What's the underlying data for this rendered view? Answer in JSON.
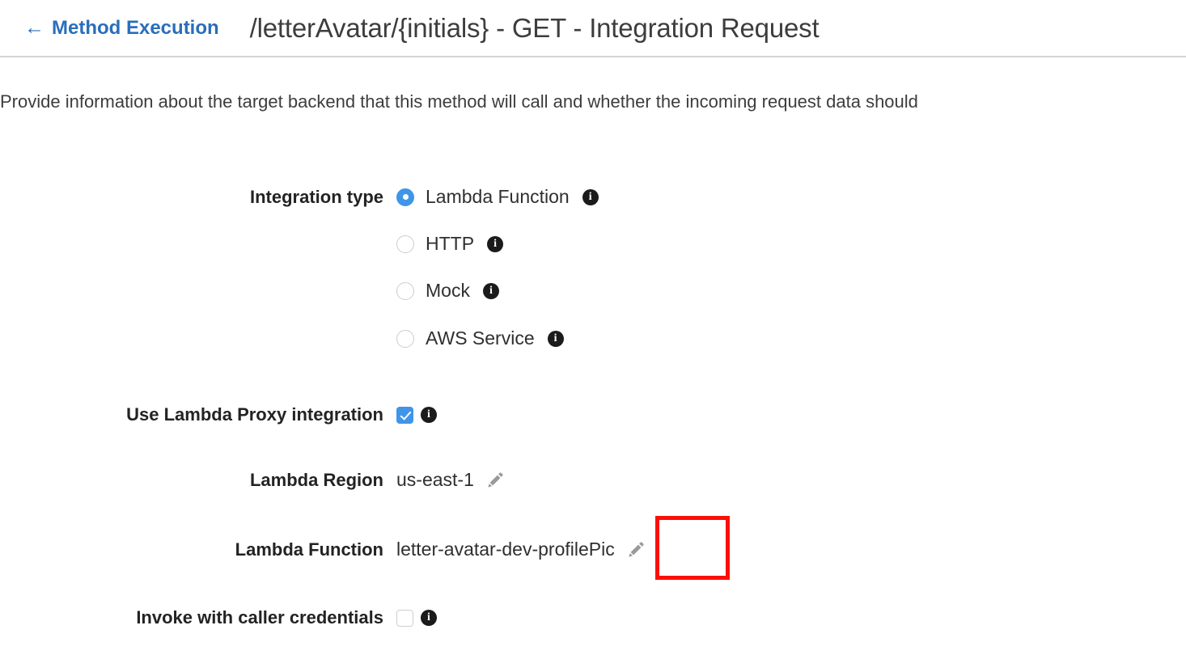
{
  "header": {
    "back_arrow_glyph": "←",
    "back_link_label": "Method Execution",
    "title": "/letterAvatar/{initials} - GET - Integration Request"
  },
  "description": "Provide information about the target backend that this method will call and whether the incoming request data should",
  "form": {
    "integration_type": {
      "label": "Integration type",
      "selected": "Lambda Function",
      "options": [
        {
          "label": "Lambda Function",
          "checked": true
        },
        {
          "label": "HTTP",
          "checked": false
        },
        {
          "label": "Mock",
          "checked": false
        },
        {
          "label": "AWS Service",
          "checked": false
        }
      ]
    },
    "lambda_proxy": {
      "label": "Use Lambda Proxy integration",
      "checked": true
    },
    "lambda_region": {
      "label": "Lambda Region",
      "value": "us-east-1",
      "edit_icon": "pencil-icon"
    },
    "lambda_function": {
      "label": "Lambda Function",
      "value": "letter-avatar-dev-profilePic",
      "edit_icon": "pencil-icon",
      "highlighted": true
    },
    "caller_credentials": {
      "label": "Invoke with caller credentials",
      "checked": false
    },
    "info_icon_glyph": "i",
    "info_icon_name": "info-icon"
  },
  "colors": {
    "link_blue": "#2a6ebb",
    "control_blue": "#3f95e8",
    "highlight_red": "#fb0f08",
    "text_dark": "#2f2f2f",
    "divider_gray": "#d4d4d4"
  }
}
